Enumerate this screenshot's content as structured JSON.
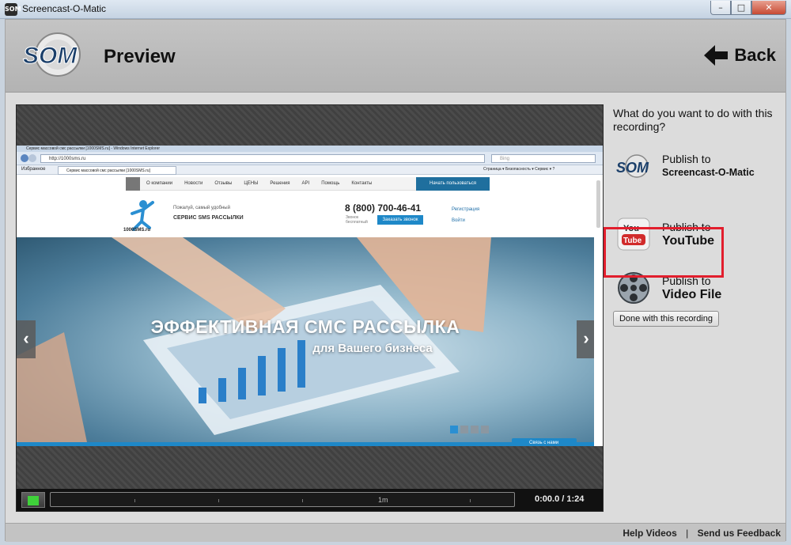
{
  "window": {
    "title": "Screencast-O-Matic",
    "min": "–",
    "max": "□",
    "close": "✕"
  },
  "header": {
    "logo_text": "SOM",
    "title": "Preview",
    "back_label": "Back"
  },
  "preview": {
    "browser": {
      "title": "Сервис массовой смс рассылки [1000SMS.ru] - Windows Internet Explorer",
      "url": "http://1000sms.ru",
      "search_placeholder": "Bing",
      "favorites": "Избранное",
      "tab": "Сервис массовой смс рассылки [1000SMS.ru]",
      "tools": "Страница ▾  Безопасность ▾  Сервис ▾  ?"
    },
    "site": {
      "nav": [
        "О компании",
        "Новости",
        "Отзывы",
        "ЦЕНЫ",
        "Решения",
        "API",
        "Помощь",
        "Контакты"
      ],
      "cta": "Начать пользоваться",
      "logo": "1000SMS.ru",
      "tagline": "Пожалуй, самый удобный",
      "service": "СЕРВИС SMS РАССЫЛКИ",
      "phone": "8 (800) 700-46-41",
      "phone_note": "Звонок бесплатный",
      "callback": "Заказать звонок",
      "register": "Регистрация",
      "login": "Войти",
      "hero_title": "ЭФФЕКТИВНАЯ СМС РАССЫЛКА",
      "hero_subtitle": "для Вашего бизнеса",
      "chat": "Связь с нами",
      "prev": "‹",
      "next": "›"
    },
    "player": {
      "tick_label": "1m",
      "time": "0:00.0 / 1:24",
      "current": "0:00.0",
      "total": "1:24"
    }
  },
  "right_panel": {
    "question": "What do you want to do with this recording?",
    "options": [
      {
        "line1": "Publish to",
        "line2": "Screencast-O-Matic",
        "icon": "som-icon"
      },
      {
        "line1": "Publish to",
        "line2": "YouTube",
        "icon": "youtube-icon"
      },
      {
        "line1": "Publish to",
        "line2": "Video File",
        "icon": "film-reel-icon"
      }
    ],
    "done_label": "Done with this recording"
  },
  "footer": {
    "help": "Help Videos",
    "separator": "|",
    "feedback": "Send us Feedback"
  },
  "colors": {
    "highlight": "#e21e2d",
    "cta_blue": "#1e88c8",
    "play_green": "#3fd13a"
  }
}
